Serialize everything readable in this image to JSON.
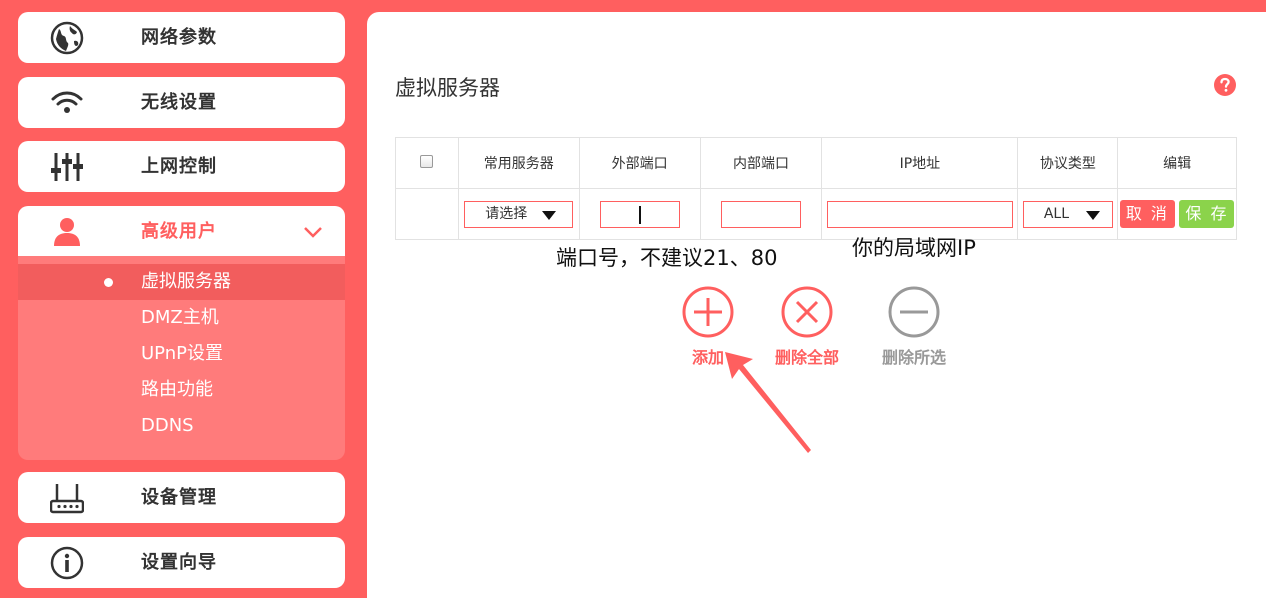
{
  "sidebar": {
    "items": [
      {
        "label": "网络参数",
        "icon": "globe-icon"
      },
      {
        "label": "无线设置",
        "icon": "wifi-icon"
      },
      {
        "label": "上网控制",
        "icon": "sliders-icon"
      },
      {
        "label": "高级用户",
        "icon": "user-icon"
      },
      {
        "label": "设备管理",
        "icon": "router-icon"
      },
      {
        "label": "设置向导",
        "icon": "info-icon"
      }
    ],
    "submenu": [
      "虚拟服务器",
      "DMZ主机",
      "UPnP设置",
      "路由功能",
      "DDNS"
    ]
  },
  "main": {
    "title": "虚拟服务器",
    "columns": [
      "常用服务器",
      "外部端口",
      "内部端口",
      "IP地址",
      "协议类型",
      "编辑"
    ],
    "row": {
      "server_select": "请选择",
      "protocol_select": "ALL",
      "cancel": "取 消",
      "save": "保 存"
    },
    "annotations": {
      "port_note": "端口号，不建议21、80",
      "ip_note": "你的局域网IP"
    },
    "actions": {
      "add": "添加",
      "delete_all": "删除全部",
      "delete_selected": "删除所选"
    }
  },
  "colors": {
    "accent": "#ff5f5f",
    "save": "#8bd34b",
    "disabled": "#999999"
  }
}
